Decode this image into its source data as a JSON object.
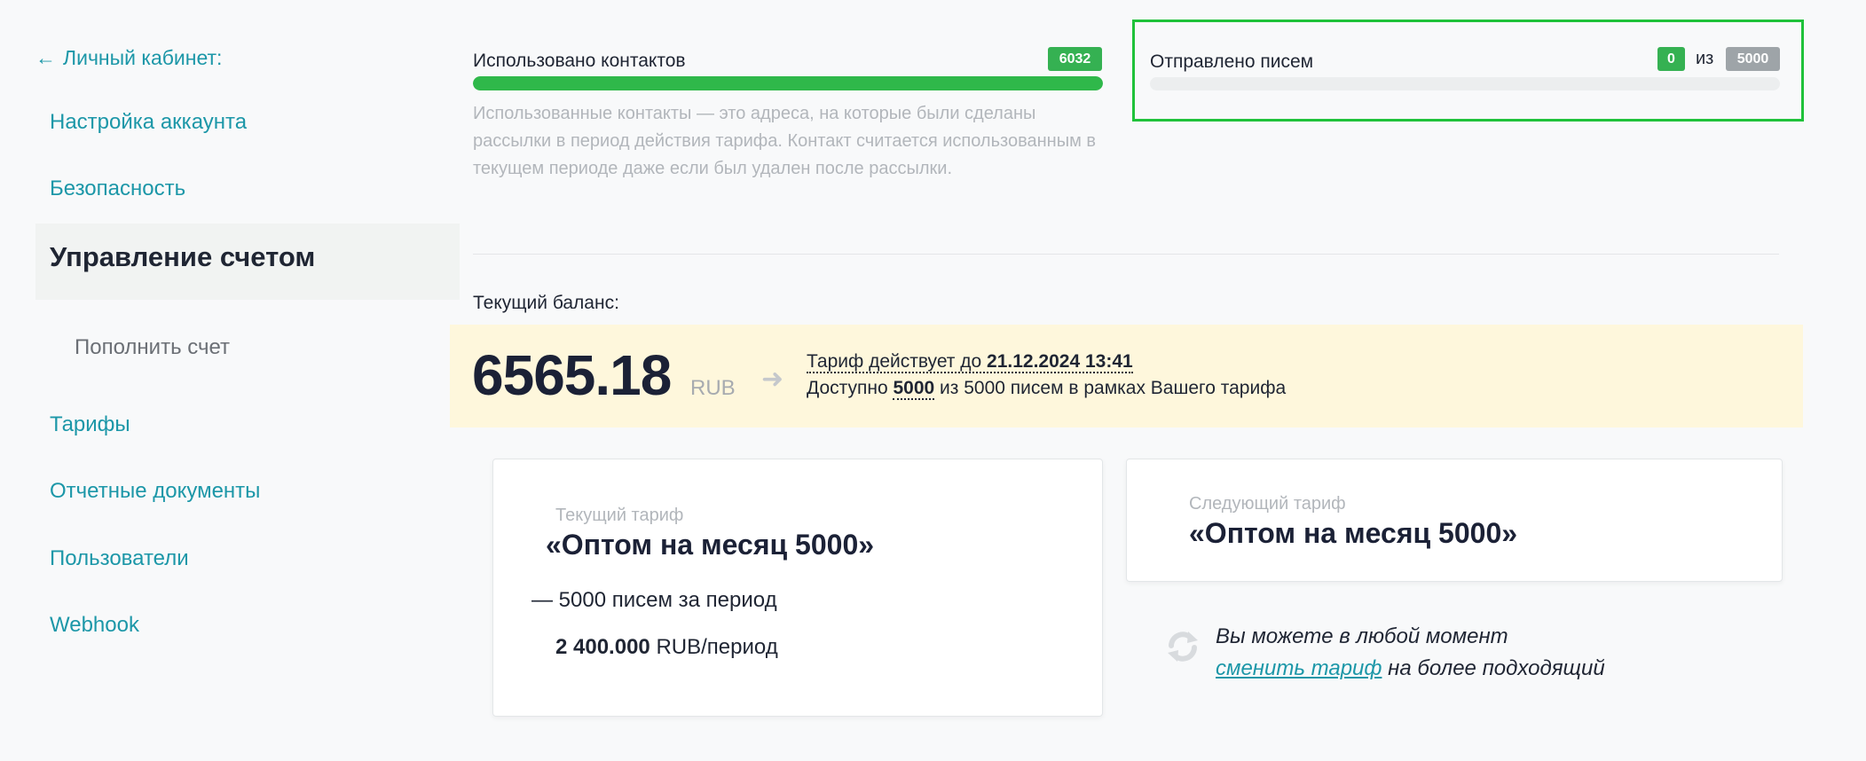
{
  "sidebar": {
    "back_label": "Личный кабинет:",
    "items": [
      {
        "label": "Настройка аккаунта"
      },
      {
        "label": "Безопасность"
      },
      {
        "label": "Управление счетом"
      },
      {
        "label": "Пополнить счет"
      },
      {
        "label": "Тарифы"
      },
      {
        "label": "Отчетные документы"
      },
      {
        "label": "Пользователи"
      },
      {
        "label": "Webhook"
      }
    ],
    "active_index": 2
  },
  "contacts": {
    "label": "Использовано контактов",
    "count": "6032",
    "progress_percent": 100,
    "hint": "Использованные контакты — это адреса, на которые были сделаны рассылки в период действия тарифа. Контакт считается использованным в текущем периоде даже если был удален после рассылки."
  },
  "letters": {
    "label": "Отправлено писем",
    "sent": "0",
    "separator": "из",
    "total": "5000",
    "progress_percent": 0
  },
  "balance": {
    "label": "Текущий баланс:",
    "amount": "6565.18",
    "currency": "RUB",
    "tariff_valid_prefix": "Тариф действует до",
    "tariff_valid_date": "21.12.2024 13:41",
    "available_prefix": "Доступно",
    "available_count": "5000",
    "available_suffix": "из 5000 писем в рамках Вашего тарифа"
  },
  "current_tariff": {
    "caption": "Текущий тариф",
    "name": "«Оптом на месяц 5000»",
    "feature": "— 5000 писем за период",
    "price": "2 400.000",
    "price_unit": "RUB/период"
  },
  "next_tariff": {
    "caption": "Следующий тариф",
    "name": "«Оптом на месяц 5000»"
  },
  "change_hint": {
    "line1": "Вы можете в любой момент",
    "link": "сменить тариф",
    "line2_suffix": "на более подходящий"
  },
  "colors": {
    "accent": "#1c97a8",
    "success": "#2fb84a",
    "highlight_frame": "#1fc23a",
    "balance_bg": "#fef7dc"
  },
  "icons": {
    "back": "arrow-left-icon",
    "balance_arrow": "arrow-right-icon",
    "change": "refresh-icon"
  }
}
